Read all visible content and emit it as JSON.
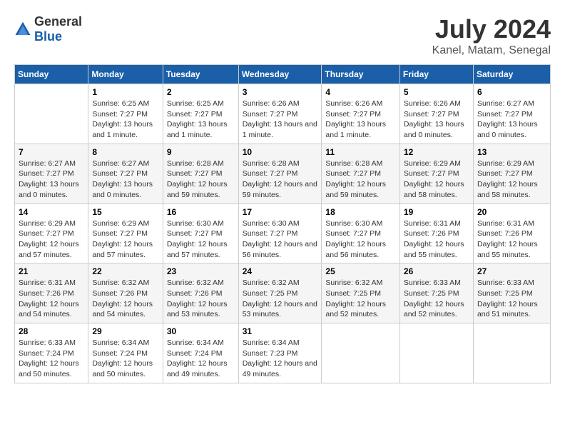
{
  "logo": {
    "general": "General",
    "blue": "Blue"
  },
  "title": "July 2024",
  "subtitle": "Kanel, Matam, Senegal",
  "days_of_week": [
    "Sunday",
    "Monday",
    "Tuesday",
    "Wednesday",
    "Thursday",
    "Friday",
    "Saturday"
  ],
  "weeks": [
    [
      {
        "day": "",
        "info": ""
      },
      {
        "day": "1",
        "info": "Sunrise: 6:25 AM\nSunset: 7:27 PM\nDaylight: 13 hours and 1 minute."
      },
      {
        "day": "2",
        "info": "Sunrise: 6:25 AM\nSunset: 7:27 PM\nDaylight: 13 hours and 1 minute."
      },
      {
        "day": "3",
        "info": "Sunrise: 6:26 AM\nSunset: 7:27 PM\nDaylight: 13 hours and 1 minute."
      },
      {
        "day": "4",
        "info": "Sunrise: 6:26 AM\nSunset: 7:27 PM\nDaylight: 13 hours and 1 minute."
      },
      {
        "day": "5",
        "info": "Sunrise: 6:26 AM\nSunset: 7:27 PM\nDaylight: 13 hours and 0 minutes."
      },
      {
        "day": "6",
        "info": "Sunrise: 6:27 AM\nSunset: 7:27 PM\nDaylight: 13 hours and 0 minutes."
      }
    ],
    [
      {
        "day": "7",
        "info": "Sunrise: 6:27 AM\nSunset: 7:27 PM\nDaylight: 13 hours and 0 minutes."
      },
      {
        "day": "8",
        "info": "Sunrise: 6:27 AM\nSunset: 7:27 PM\nDaylight: 13 hours and 0 minutes."
      },
      {
        "day": "9",
        "info": "Sunrise: 6:28 AM\nSunset: 7:27 PM\nDaylight: 12 hours and 59 minutes."
      },
      {
        "day": "10",
        "info": "Sunrise: 6:28 AM\nSunset: 7:27 PM\nDaylight: 12 hours and 59 minutes."
      },
      {
        "day": "11",
        "info": "Sunrise: 6:28 AM\nSunset: 7:27 PM\nDaylight: 12 hours and 59 minutes."
      },
      {
        "day": "12",
        "info": "Sunrise: 6:29 AM\nSunset: 7:27 PM\nDaylight: 12 hours and 58 minutes."
      },
      {
        "day": "13",
        "info": "Sunrise: 6:29 AM\nSunset: 7:27 PM\nDaylight: 12 hours and 58 minutes."
      }
    ],
    [
      {
        "day": "14",
        "info": "Sunrise: 6:29 AM\nSunset: 7:27 PM\nDaylight: 12 hours and 57 minutes."
      },
      {
        "day": "15",
        "info": "Sunrise: 6:29 AM\nSunset: 7:27 PM\nDaylight: 12 hours and 57 minutes."
      },
      {
        "day": "16",
        "info": "Sunrise: 6:30 AM\nSunset: 7:27 PM\nDaylight: 12 hours and 57 minutes."
      },
      {
        "day": "17",
        "info": "Sunrise: 6:30 AM\nSunset: 7:27 PM\nDaylight: 12 hours and 56 minutes."
      },
      {
        "day": "18",
        "info": "Sunrise: 6:30 AM\nSunset: 7:27 PM\nDaylight: 12 hours and 56 minutes."
      },
      {
        "day": "19",
        "info": "Sunrise: 6:31 AM\nSunset: 7:26 PM\nDaylight: 12 hours and 55 minutes."
      },
      {
        "day": "20",
        "info": "Sunrise: 6:31 AM\nSunset: 7:26 PM\nDaylight: 12 hours and 55 minutes."
      }
    ],
    [
      {
        "day": "21",
        "info": "Sunrise: 6:31 AM\nSunset: 7:26 PM\nDaylight: 12 hours and 54 minutes."
      },
      {
        "day": "22",
        "info": "Sunrise: 6:32 AM\nSunset: 7:26 PM\nDaylight: 12 hours and 54 minutes."
      },
      {
        "day": "23",
        "info": "Sunrise: 6:32 AM\nSunset: 7:26 PM\nDaylight: 12 hours and 53 minutes."
      },
      {
        "day": "24",
        "info": "Sunrise: 6:32 AM\nSunset: 7:25 PM\nDaylight: 12 hours and 53 minutes."
      },
      {
        "day": "25",
        "info": "Sunrise: 6:32 AM\nSunset: 7:25 PM\nDaylight: 12 hours and 52 minutes."
      },
      {
        "day": "26",
        "info": "Sunrise: 6:33 AM\nSunset: 7:25 PM\nDaylight: 12 hours and 52 minutes."
      },
      {
        "day": "27",
        "info": "Sunrise: 6:33 AM\nSunset: 7:25 PM\nDaylight: 12 hours and 51 minutes."
      }
    ],
    [
      {
        "day": "28",
        "info": "Sunrise: 6:33 AM\nSunset: 7:24 PM\nDaylight: 12 hours and 50 minutes."
      },
      {
        "day": "29",
        "info": "Sunrise: 6:34 AM\nSunset: 7:24 PM\nDaylight: 12 hours and 50 minutes."
      },
      {
        "day": "30",
        "info": "Sunrise: 6:34 AM\nSunset: 7:24 PM\nDaylight: 12 hours and 49 minutes."
      },
      {
        "day": "31",
        "info": "Sunrise: 6:34 AM\nSunset: 7:23 PM\nDaylight: 12 hours and 49 minutes."
      },
      {
        "day": "",
        "info": ""
      },
      {
        "day": "",
        "info": ""
      },
      {
        "day": "",
        "info": ""
      }
    ]
  ]
}
